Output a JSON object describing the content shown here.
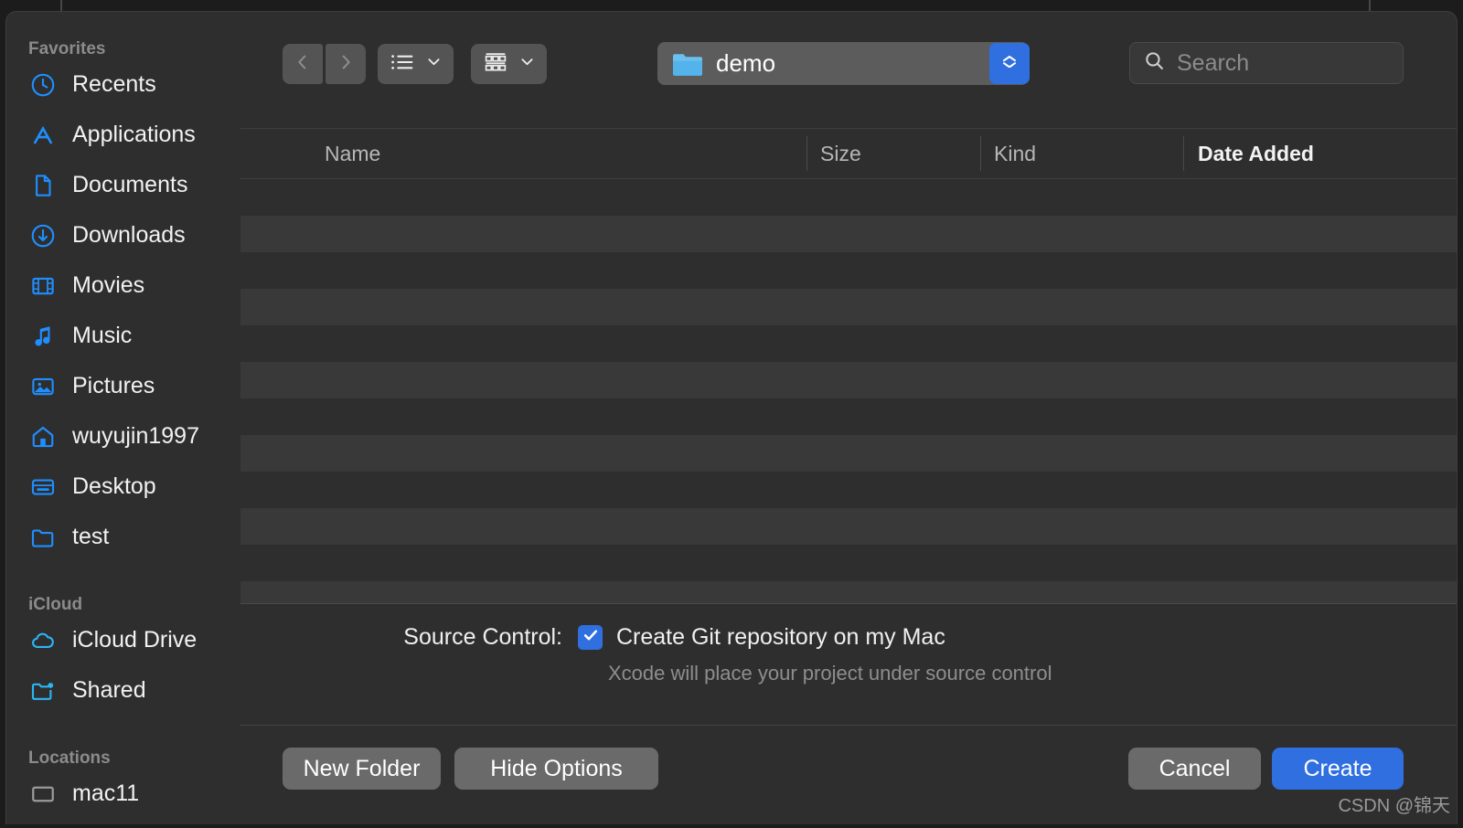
{
  "toolbar": {
    "back_icon": "chevron-left-icon",
    "forward_icon": "chevron-right-icon",
    "list_view_icon": "list-view-icon",
    "grid_view_icon": "grid-view-icon",
    "path_popup_value": "demo",
    "path_folder_icon": "folder-icon",
    "stepper_icon": "up-down-chevron-icon",
    "search_placeholder": "Search",
    "search_value": "",
    "search_icon": "magnifier-icon"
  },
  "sidebar": {
    "sections": [
      {
        "title": "Favorites",
        "items": [
          {
            "label": "Recents",
            "icon": "clock-icon"
          },
          {
            "label": "Applications",
            "icon": "applications-icon"
          },
          {
            "label": "Documents",
            "icon": "document-icon"
          },
          {
            "label": "Downloads",
            "icon": "download-icon"
          },
          {
            "label": "Movies",
            "icon": "film-icon"
          },
          {
            "label": "Music",
            "icon": "music-note-icon"
          },
          {
            "label": "Pictures",
            "icon": "picture-icon"
          },
          {
            "label": "wuyujin1997",
            "icon": "home-icon"
          },
          {
            "label": "Desktop",
            "icon": "desktop-icon"
          },
          {
            "label": "test",
            "icon": "folder-icon"
          }
        ]
      },
      {
        "title": "iCloud",
        "items": [
          {
            "label": "iCloud Drive",
            "icon": "cloud-icon"
          },
          {
            "label": "Shared",
            "icon": "shared-folder-icon"
          }
        ]
      },
      {
        "title": "Locations",
        "items": [
          {
            "label": "mac11",
            "icon": "computer-icon"
          }
        ]
      }
    ]
  },
  "file_list": {
    "columns": [
      {
        "label": "Name",
        "active": false
      },
      {
        "label": "Size",
        "active": false
      },
      {
        "label": "Kind",
        "active": false
      },
      {
        "label": "Date Added",
        "active": true
      }
    ],
    "rows": []
  },
  "options": {
    "source_control_label": "Source Control:",
    "git_checkbox_checked": true,
    "git_checkbox_label": "Create Git repository on my Mac",
    "git_help_text": "Xcode will place your project under source control"
  },
  "footer": {
    "new_folder_label": "New Folder",
    "hide_options_label": "Hide Options",
    "cancel_label": "Cancel",
    "create_label": "Create"
  },
  "watermark": "CSDN @锦天",
  "colors": {
    "accent_blue": "#2f6fe0",
    "sidebar_icon_blue": "#1e8fff",
    "icloud_icon_blue": "#29b6f6",
    "sheet_background": "#2e2e2e",
    "row_alt": "#393939"
  }
}
